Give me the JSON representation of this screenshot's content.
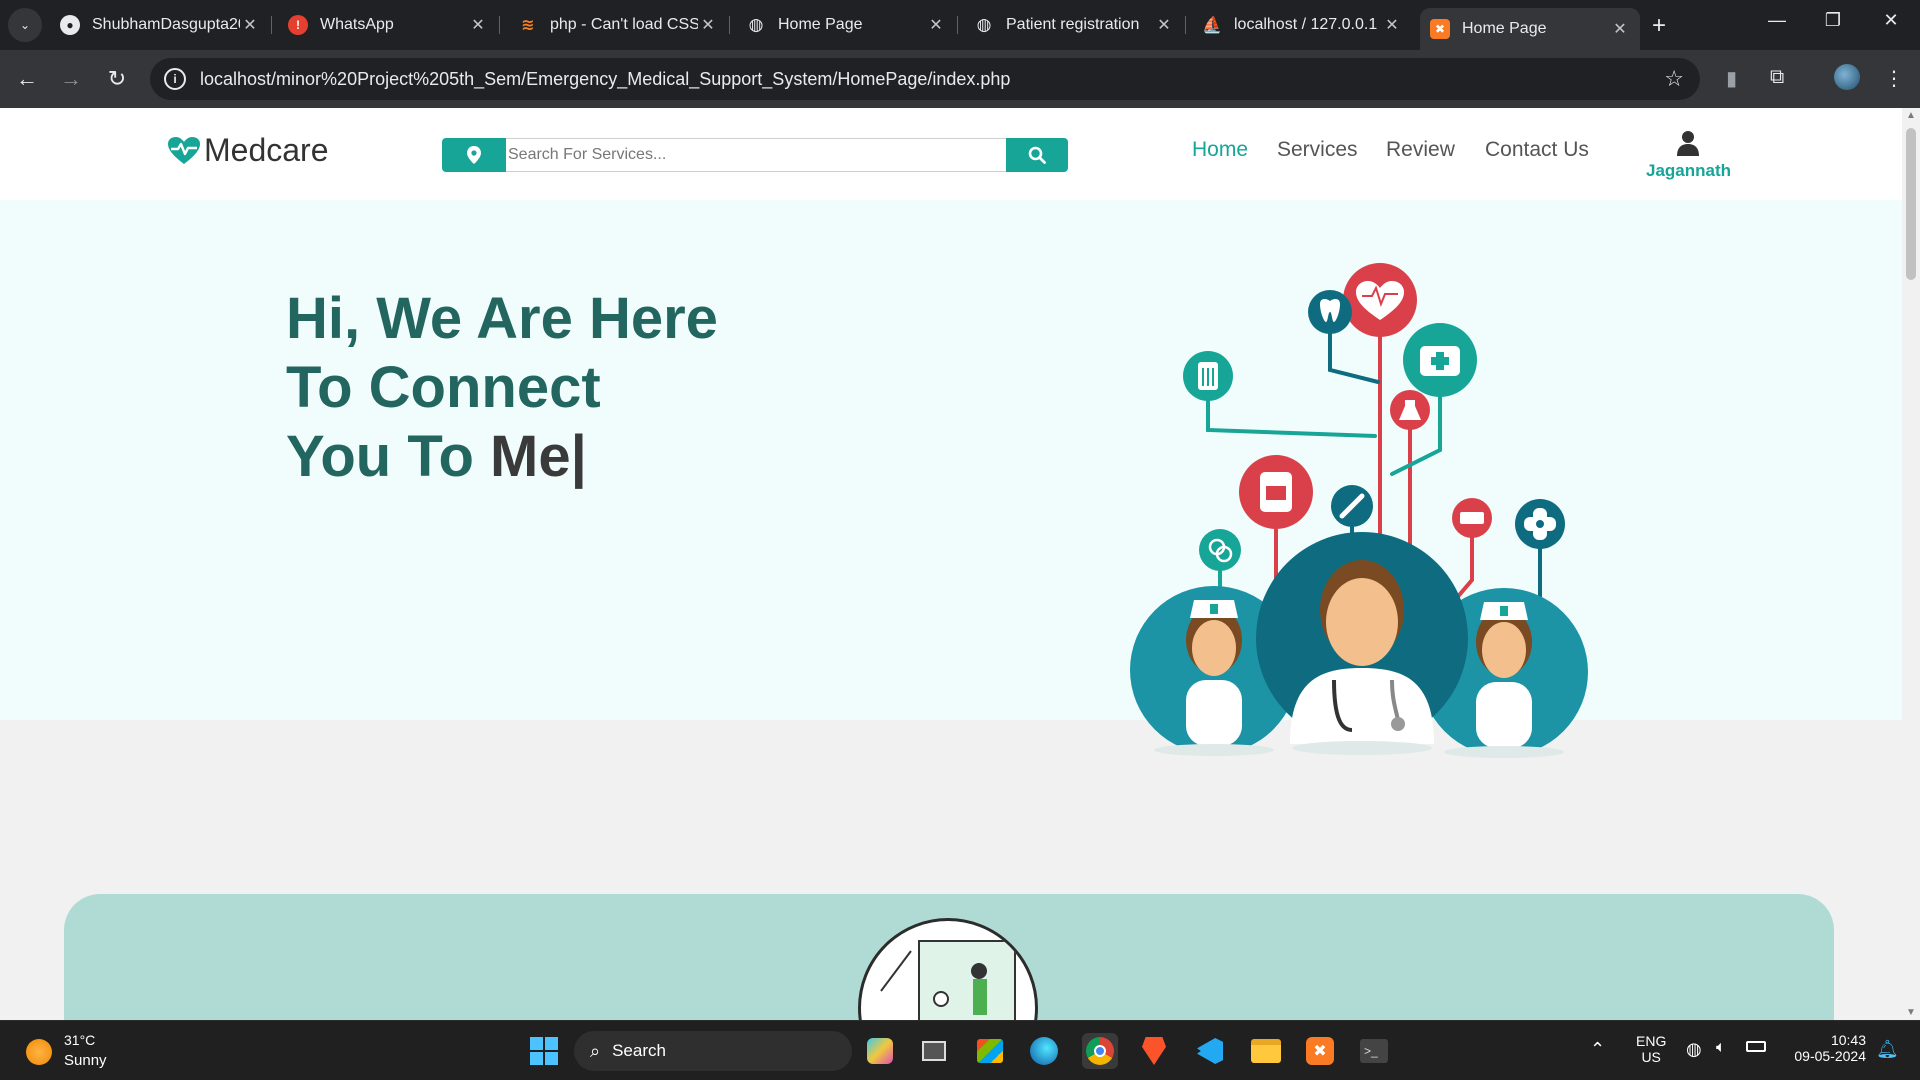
{
  "browser": {
    "tabs": [
      {
        "title": "ShubhamDasgupta20",
        "icon": "github-icon",
        "active": false
      },
      {
        "title": "WhatsApp",
        "icon": "whatsapp-icon",
        "active": false
      },
      {
        "title": "php - Can't load CSS",
        "icon": "stackoverflow-icon",
        "active": false
      },
      {
        "title": "Home Page",
        "icon": "globe-icon",
        "active": false
      },
      {
        "title": "Patient registration",
        "icon": "globe-icon",
        "active": false
      },
      {
        "title": "localhost / 127.0.0.1",
        "icon": "phpmyadmin-icon",
        "active": false
      },
      {
        "title": "Home Page",
        "icon": "xampp-icon",
        "active": true
      }
    ],
    "url": "localhost/minor%20Project%205th_Sem/Emergency_Medical_Support_System/HomePage/index.php"
  },
  "site": {
    "brand": "Medcare",
    "search_placeholder": "Search For Services...",
    "nav": {
      "home": "Home",
      "services": "Services",
      "review": "Review",
      "contact": "Contact Us"
    },
    "user_name": "Jagannath",
    "hero": {
      "line1": "Hi, We Are Here",
      "line2": "To Connect",
      "line3_prefix": "You To ",
      "line3_typed": "Me|"
    }
  },
  "taskbar": {
    "weather_temp": "31°C",
    "weather_cond": "Sunny",
    "search_label": "Search",
    "lang_top": "ENG",
    "lang_bottom": "US",
    "time": "10:43",
    "date": "09-05-2024"
  },
  "colors": {
    "brand_teal": "#17a598",
    "hero_title": "#22665f",
    "hero_bg": "#f0fdfc",
    "panel_bg": "#b0dbd5",
    "accent_red": "#d9404a",
    "dark_teal": "#0f6c80"
  }
}
